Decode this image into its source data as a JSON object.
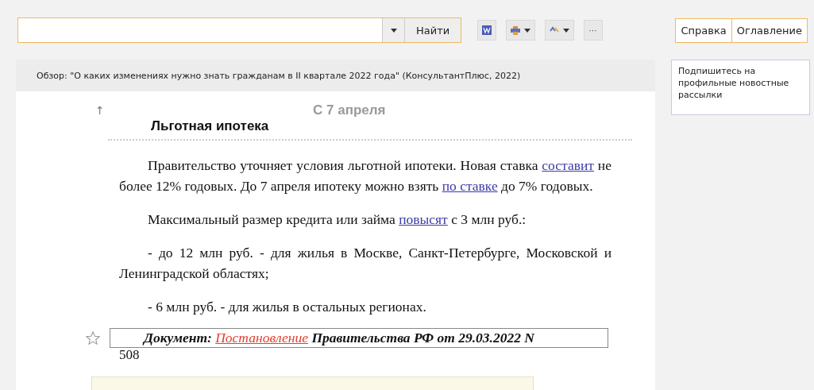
{
  "toolbar": {
    "search_button": "Найти",
    "tools": [
      {
        "kind": "word",
        "dropdown": false
      },
      {
        "kind": "print",
        "dropdown": true
      },
      {
        "kind": "export",
        "dropdown": true
      },
      {
        "kind": "more",
        "label": "···",
        "dropdown": false
      }
    ],
    "nav_buttons": [
      "Справка",
      "Оглавление"
    ]
  },
  "document": {
    "header": "Обзор: \"О каких изменениях нужно знать гражданам в II квартале 2022 года\" (КонсультантПлюс, 2022)",
    "up_arrow": "↑",
    "date": "С 7 апреля",
    "heading": "Льготная ипотека",
    "paragraphs": [
      [
        {
          "text": "Правительство уточняет условия льготной ипотеки. Новая ставка ",
          "link": false
        },
        {
          "text": "составит",
          "link": true
        },
        {
          "text": " не более 12% годовых. До 7 апреля ипотеку можно взять ",
          "link": false
        },
        {
          "text": "по ставке",
          "link": true
        },
        {
          "text": " до 7% годовых.",
          "link": false
        }
      ],
      [
        {
          "text": "Максимальный размер кредита или займа ",
          "link": false
        },
        {
          "text": "повысят",
          "link": true
        },
        {
          "text": " с 3 млн руб.:",
          "link": false
        }
      ],
      [
        {
          "text": "- до 12 млн руб. - для жилья в Москве, Санкт-Петербурге, Московской и Ленинградской областях;",
          "link": false
        }
      ],
      [
        {
          "text": "- 6 млн руб. - для жилья в остальных регионах.",
          "link": false
        }
      ]
    ],
    "document_ref": {
      "starred": false,
      "label": "Документ:",
      "link": "Постановление",
      "rest": "Правительства РФ от 29.03.2022 N",
      "continuation": "508"
    }
  },
  "sidebar": {
    "notice": "Подпишитесь на профильные новостные рассылки"
  }
}
